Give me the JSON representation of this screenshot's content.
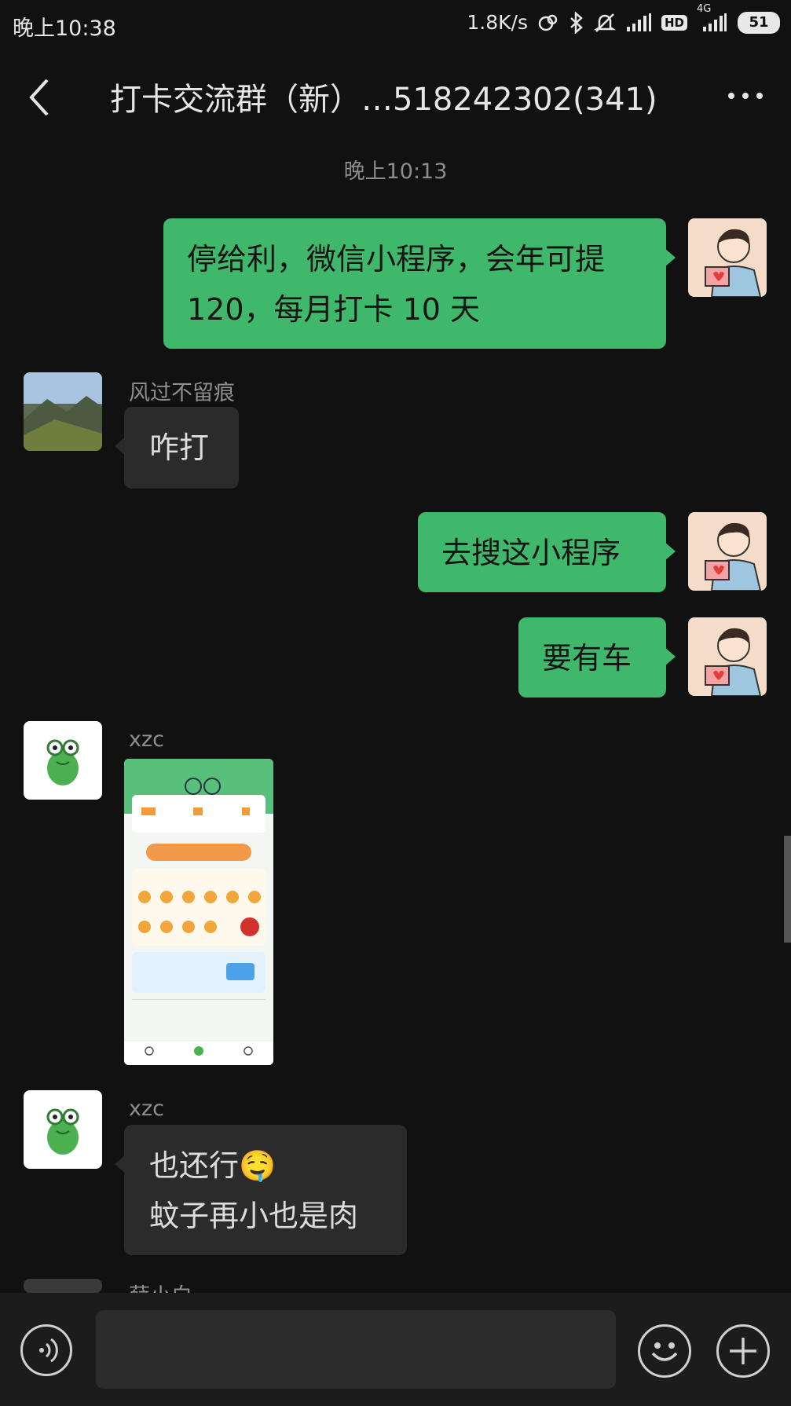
{
  "status_bar": {
    "time": "晚上10:38",
    "net_speed": "1.8K/s",
    "network_type": "4G",
    "hd_label": "HD",
    "battery": "51",
    "icons": [
      "link-icon",
      "bluetooth-icon",
      "mute-bell-icon",
      "signal-icon",
      "hd-icon",
      "4g-signal-icon",
      "battery-icon"
    ]
  },
  "header": {
    "title": "打卡交流群（新）…518242302(341)",
    "back_icon": "back-arrow-icon",
    "more_icon": "more-dots-icon"
  },
  "timestamp": "晚上10:13",
  "messages": [
    {
      "direction": "out",
      "lines": [
        "停给利，微信小程序，会年可提",
        "120，每月打卡 10 天"
      ]
    },
    {
      "direction": "in",
      "sender": "风过不留痕",
      "lines": [
        "咋打"
      ]
    },
    {
      "direction": "out",
      "lines": [
        "去搜这小程序"
      ]
    },
    {
      "direction": "out",
      "lines": [
        "要有车"
      ]
    },
    {
      "direction": "in",
      "sender": "xzc",
      "type": "image"
    },
    {
      "direction": "in",
      "sender": "xzc",
      "lines": [
        "也还行🤤",
        "蚊子再小也是肉"
      ]
    },
    {
      "direction": "in",
      "sender": "薛小白",
      "partial": true
    }
  ],
  "input_bar": {
    "voice_icon": "voice-icon",
    "emoji_icon": "emoji-icon",
    "plus_icon": "plus-icon",
    "input_value": ""
  },
  "colors": {
    "background": "#111111",
    "bubble_out": "#3fb86b",
    "bubble_in": "#2b2b2b",
    "input_bar": "#1c1c1c"
  }
}
